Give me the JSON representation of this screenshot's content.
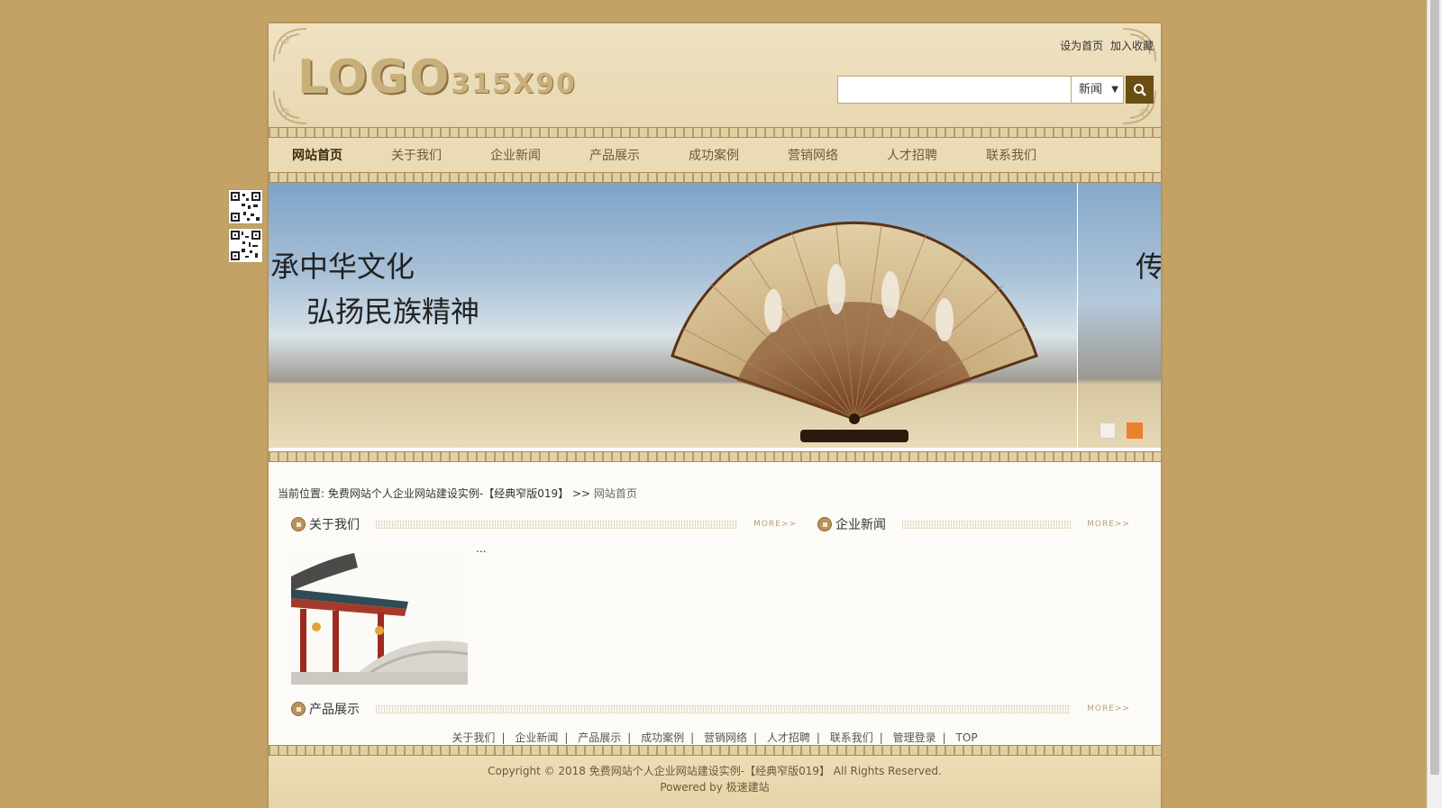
{
  "top_links": {
    "home": "设为首页",
    "favorite": "加入收藏"
  },
  "logo": {
    "big": "LOGO",
    "small": "315X90"
  },
  "search": {
    "placeholder": "",
    "category": "新闻"
  },
  "nav": [
    {
      "label": "网站首页",
      "active": true
    },
    {
      "label": "关于我们"
    },
    {
      "label": "企业新闻"
    },
    {
      "label": "产品展示"
    },
    {
      "label": "成功案例"
    },
    {
      "label": "营销网络"
    },
    {
      "label": "人才招聘"
    },
    {
      "label": "联系我们"
    }
  ],
  "banner": {
    "line1": "承中华文化",
    "line2": "弘扬民族精神",
    "side_text": "传",
    "active_slide": 2,
    "slide_count": 2
  },
  "breadcrumb": {
    "prefix": "当前位置:",
    "site": "免费网站个人企业网站建设实例-【经典窄版019】",
    "sep": " >> ",
    "current": "网站首页"
  },
  "sections": {
    "about": {
      "title": "关于我们",
      "more": "MORE>>",
      "excerpt": "..."
    },
    "news": {
      "title": "企业新闻",
      "more": "MORE>>"
    },
    "products": {
      "title": "产品展示",
      "more": "MORE>>"
    }
  },
  "footer": {
    "links": [
      "关于我们",
      "企业新闻",
      "产品展示",
      "成功案例",
      "营销网络",
      "人才招聘",
      "联系我们",
      "管理登录",
      "TOP"
    ],
    "separator": "|",
    "copyright": "Copyright © 2018 免费网站个人企业网站建设实例-【经典窄版019】 All Rights Reserved.",
    "powered": "Powered by 极速建站"
  },
  "colors": {
    "page_bg": "#c4a265",
    "accent": "#6b4e12",
    "dot_active": "#ee7f2d"
  }
}
